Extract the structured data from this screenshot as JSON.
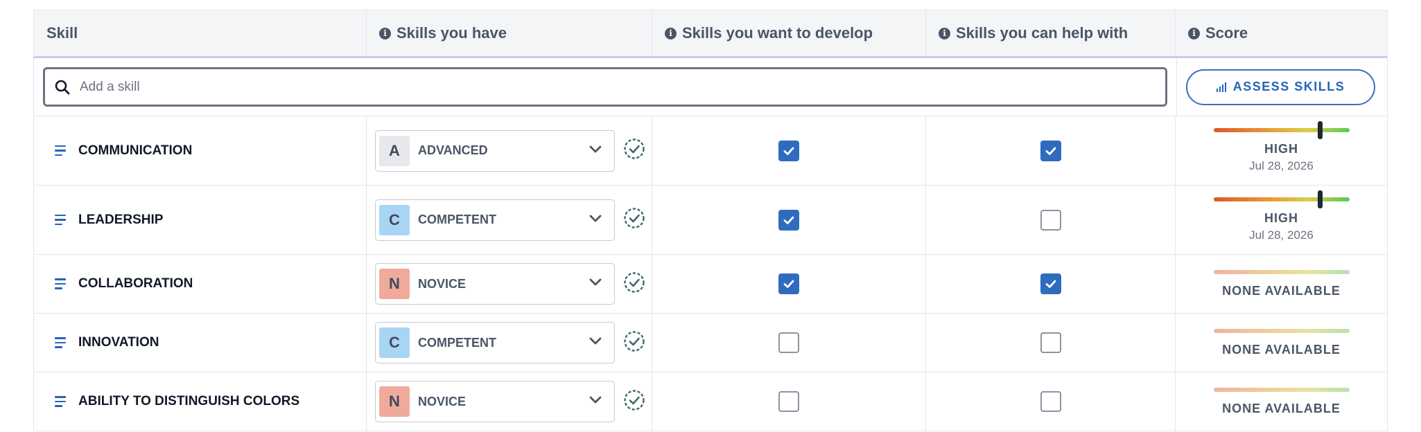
{
  "columns": {
    "skill": "Skill",
    "have": "Skills you have",
    "develop": "Skills you want to develop",
    "help": "Skills you can help with",
    "score": "Score"
  },
  "search": {
    "placeholder": "Add a skill"
  },
  "assess_button": {
    "label": "ASSESS SKILLS"
  },
  "colors": {
    "accent": "#2f6cbf",
    "advanced_badge": "#e6e8ec",
    "competent_badge": "#a9d5f5",
    "novice_badge": "#f0aa9c"
  },
  "rows": [
    {
      "skill": "COMMUNICATION",
      "level_letter": "A",
      "level": "ADVANCED",
      "level_color": "#e6e8ec",
      "develop": true,
      "help": true,
      "score_label": "HIGH",
      "score_date": "Jul 28, 2026",
      "score_fraction": 0.78
    },
    {
      "skill": "LEADERSHIP",
      "level_letter": "C",
      "level": "COMPETENT",
      "level_color": "#a9d5f5",
      "develop": true,
      "help": false,
      "score_label": "HIGH",
      "score_date": "Jul 28, 2026",
      "score_fraction": 0.78
    },
    {
      "skill": "COLLABORATION",
      "level_letter": "N",
      "level": "NOVICE",
      "level_color": "#f0aa9c",
      "develop": true,
      "help": true,
      "score_label": "NONE AVAILABLE",
      "score_date": "",
      "score_fraction": null
    },
    {
      "skill": "INNOVATION",
      "level_letter": "C",
      "level": "COMPETENT",
      "level_color": "#a9d5f5",
      "develop": false,
      "help": false,
      "score_label": "NONE AVAILABLE",
      "score_date": "",
      "score_fraction": null
    },
    {
      "skill": "ABILITY TO DISTINGUISH COLORS",
      "level_letter": "N",
      "level": "NOVICE",
      "level_color": "#f0aa9c",
      "develop": false,
      "help": false,
      "score_label": "NONE AVAILABLE",
      "score_date": "",
      "score_fraction": null
    }
  ]
}
